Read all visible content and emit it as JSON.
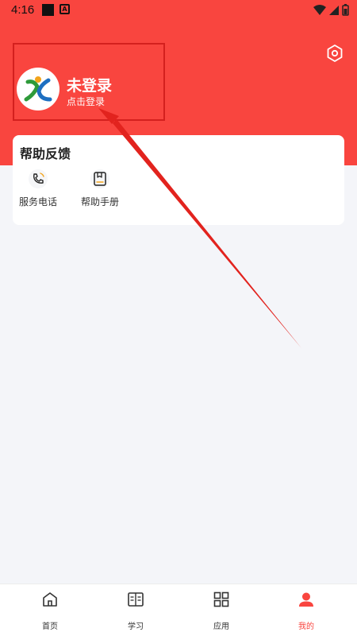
{
  "status_bar": {
    "time": "4:16",
    "icons": [
      "notification-square-icon",
      "a-icon",
      "wifi-icon",
      "signal-icon",
      "battery-icon"
    ]
  },
  "profile": {
    "name": "未登录",
    "hint": "点击登录",
    "avatar_icon": "app-logo-icon"
  },
  "help_card": {
    "title": "帮助反馈",
    "items": [
      {
        "label": "服务电话",
        "icon": "phone-icon"
      },
      {
        "label": "帮助手册",
        "icon": "manual-icon"
      }
    ]
  },
  "bottom_nav": {
    "items": [
      {
        "label": "首页",
        "icon": "home-icon"
      },
      {
        "label": "学习",
        "icon": "study-icon"
      },
      {
        "label": "应用",
        "icon": "apps-icon"
      },
      {
        "label": "我的",
        "icon": "profile-icon",
        "active": true
      }
    ]
  },
  "colors": {
    "accent": "#f9453f",
    "annotation": "#d4201e",
    "background": "#f4f5f9"
  }
}
